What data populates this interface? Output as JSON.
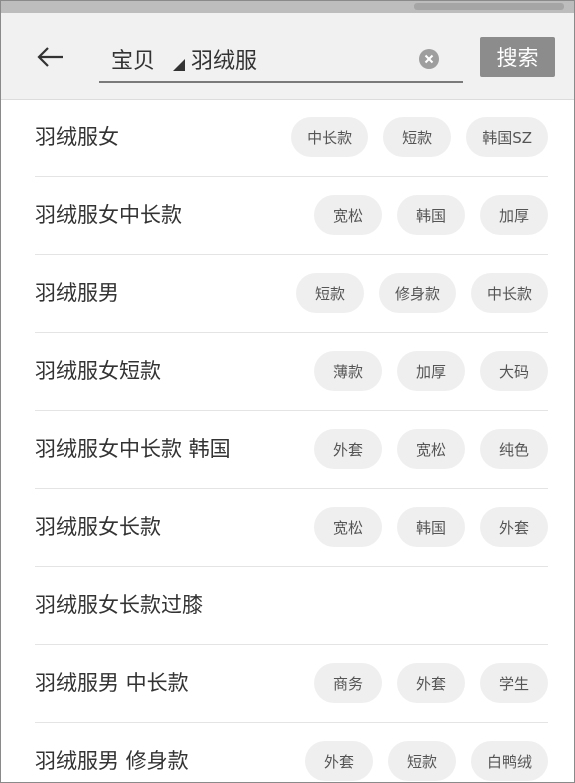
{
  "search": {
    "category": "宝贝",
    "query": "羽绒服",
    "button_label": "搜索"
  },
  "suggestions": [
    {
      "text": "羽绒服女",
      "tags": [
        "中长款",
        "短款",
        "韩国SZ"
      ]
    },
    {
      "text": "羽绒服女中长款",
      "tags": [
        "宽松",
        "韩国",
        "加厚"
      ]
    },
    {
      "text": "羽绒服男",
      "tags": [
        "短款",
        "修身款",
        "中长款"
      ]
    },
    {
      "text": "羽绒服女短款",
      "tags": [
        "薄款",
        "加厚",
        "大码"
      ]
    },
    {
      "text": "羽绒服女中长款 韩国",
      "tags": [
        "外套",
        "宽松",
        "纯色"
      ]
    },
    {
      "text": "羽绒服女长款",
      "tags": [
        "宽松",
        "韩国",
        "外套"
      ]
    },
    {
      "text": "羽绒服女长款过膝",
      "tags": []
    },
    {
      "text": "羽绒服男 中长款",
      "tags": [
        "商务",
        "外套",
        "学生"
      ]
    },
    {
      "text": "羽绒服男 修身款",
      "tags": [
        "外套",
        "短款",
        "白鸭绒"
      ]
    }
  ]
}
